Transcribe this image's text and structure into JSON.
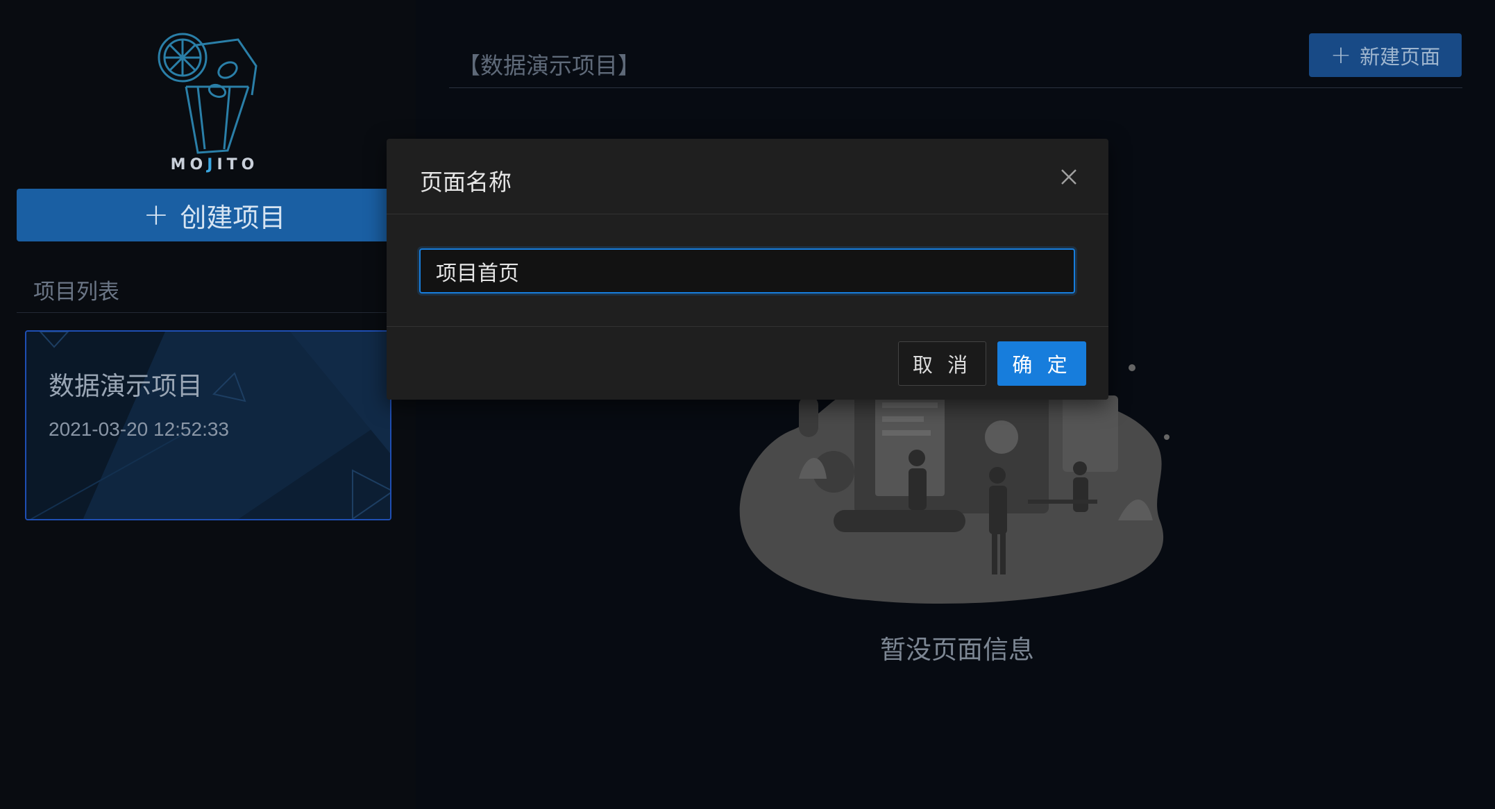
{
  "app": {
    "logo_text": "MOJITO"
  },
  "sidebar": {
    "create_button_label": "创建项目",
    "list_title": "项目列表",
    "projects": [
      {
        "name": "数据演示项目",
        "created_at": "2021-03-20 12:52:33"
      }
    ]
  },
  "main": {
    "project_header": "【数据演示项目】",
    "new_page_button_label": "新建页面",
    "empty_text": "暂没页面信息"
  },
  "modal": {
    "title": "页面名称",
    "input_value": "项目首页",
    "cancel_label": "取 消",
    "ok_label": "确 定"
  },
  "colors": {
    "accent": "#177ddc",
    "sidebar_button": "#1a5fa3",
    "background": "#070b12"
  },
  "icons": {
    "plus": "plus-icon",
    "close": "close-icon",
    "logo": "mojito-logo-icon"
  }
}
